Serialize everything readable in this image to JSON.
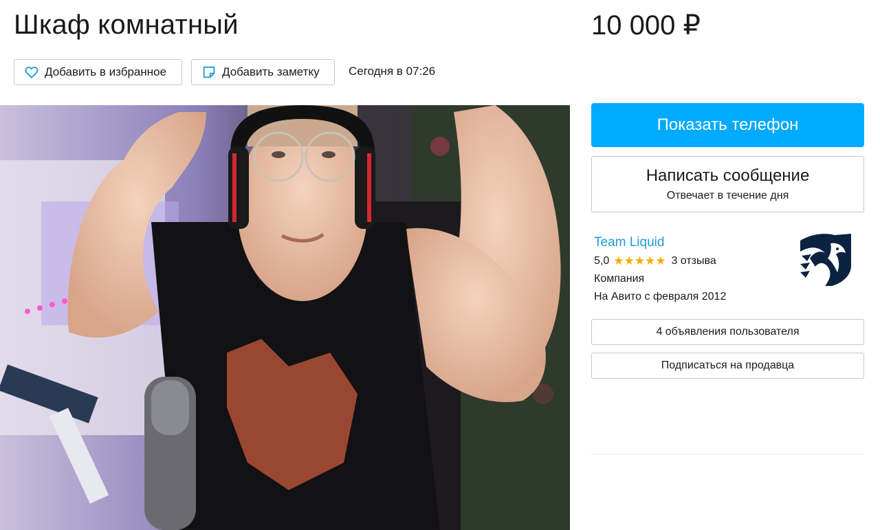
{
  "listing": {
    "title": "Шкаф комнатный",
    "price": "10 000 ₽",
    "date": "Сегодня в 07:26"
  },
  "actions": {
    "favorite_label": "Добавить в избранное",
    "note_label": "Добавить заметку"
  },
  "contact": {
    "show_phone_label": "Показать телефон",
    "message_label": "Написать сообщение",
    "message_sub": "Отвечает в течение дня"
  },
  "seller": {
    "name": "Team Liquid",
    "rating": "5,0",
    "stars": "★★★★★",
    "reviews": "3 отзыва",
    "type": "Компания",
    "since": "На Авито с февраля 2012",
    "ads_label": "4 объявления пользователя",
    "subscribe_label": "Подписаться на продавца"
  },
  "icons": {
    "favorite": "heart-icon",
    "note": "note-icon",
    "logo": "team-liquid-logo",
    "accent": "#00aaff",
    "link": "#1f9bd8",
    "star": "#ffa800"
  }
}
